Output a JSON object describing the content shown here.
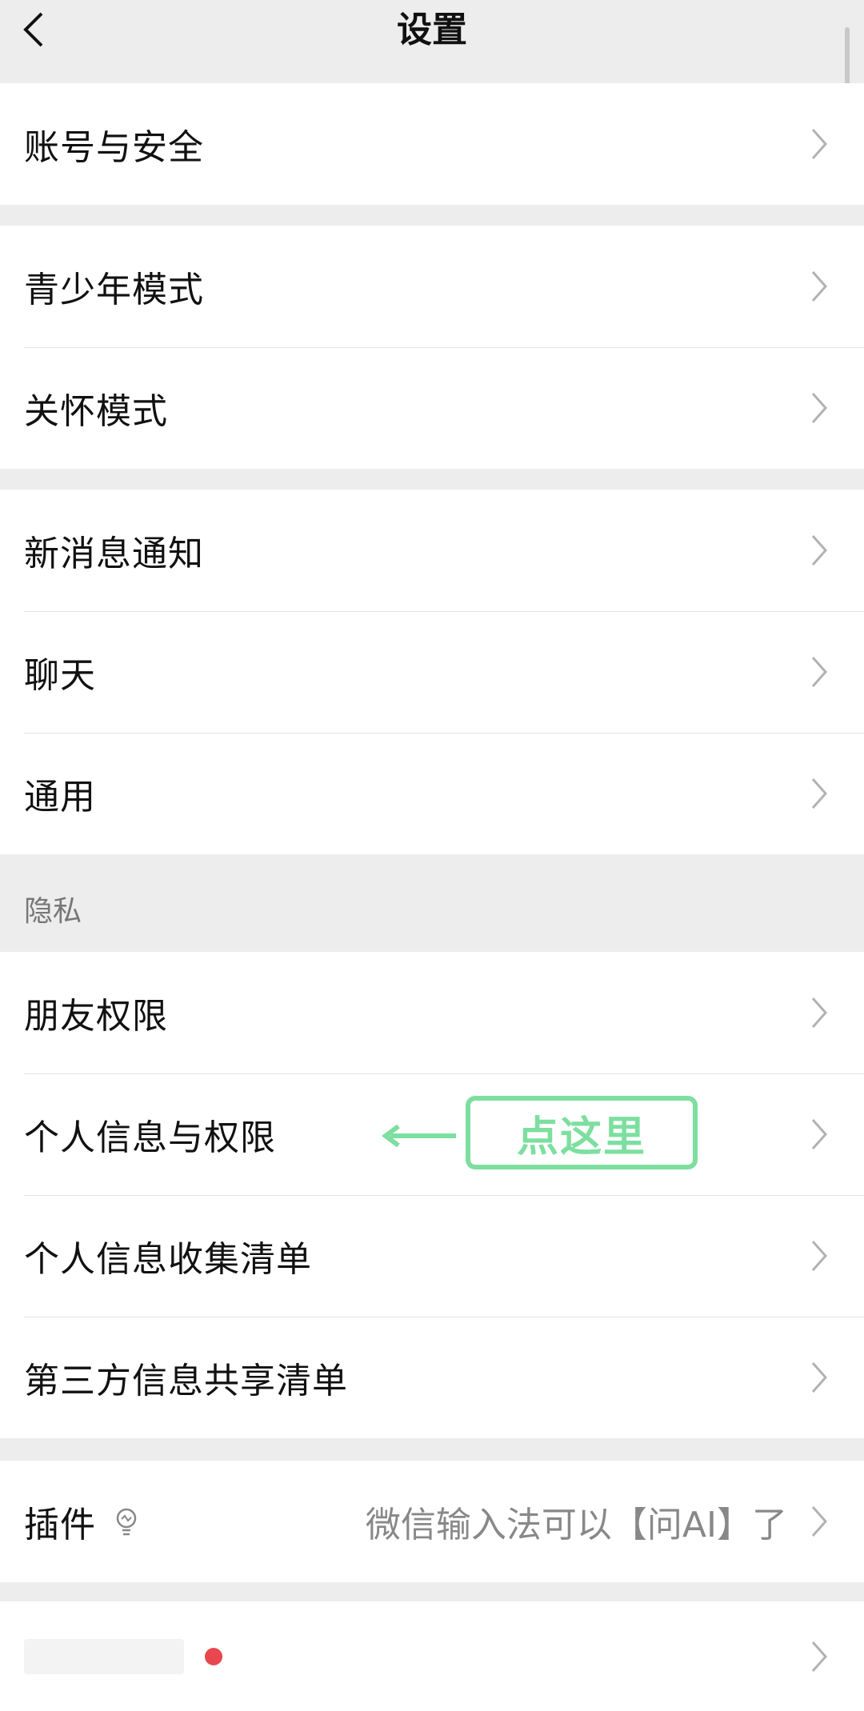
{
  "nav": {
    "title": "设置"
  },
  "groups": [
    {
      "items": [
        {
          "label": "账号与安全"
        }
      ]
    },
    {
      "items": [
        {
          "label": "青少年模式"
        },
        {
          "label": "关怀模式"
        }
      ]
    },
    {
      "items": [
        {
          "label": "新消息通知"
        },
        {
          "label": "聊天"
        },
        {
          "label": "通用"
        }
      ]
    },
    {
      "header": "隐私",
      "items": [
        {
          "label": "朋友权限"
        },
        {
          "label": "个人信息与权限"
        },
        {
          "label": "个人信息收集清单"
        },
        {
          "label": "第三方信息共享清单"
        }
      ]
    },
    {
      "items": [
        {
          "label": "插件",
          "note": "微信输入法可以【问AI】了"
        }
      ]
    }
  ],
  "annotation": {
    "text": "点这里"
  },
  "colors": {
    "accent": "#7ddf9f",
    "badge": "#e9474f",
    "background": "#ededed"
  },
  "icons": {
    "back": "chevron-left-icon",
    "row": "chevron-right-icon",
    "plugin": "lightbulb-icon"
  }
}
